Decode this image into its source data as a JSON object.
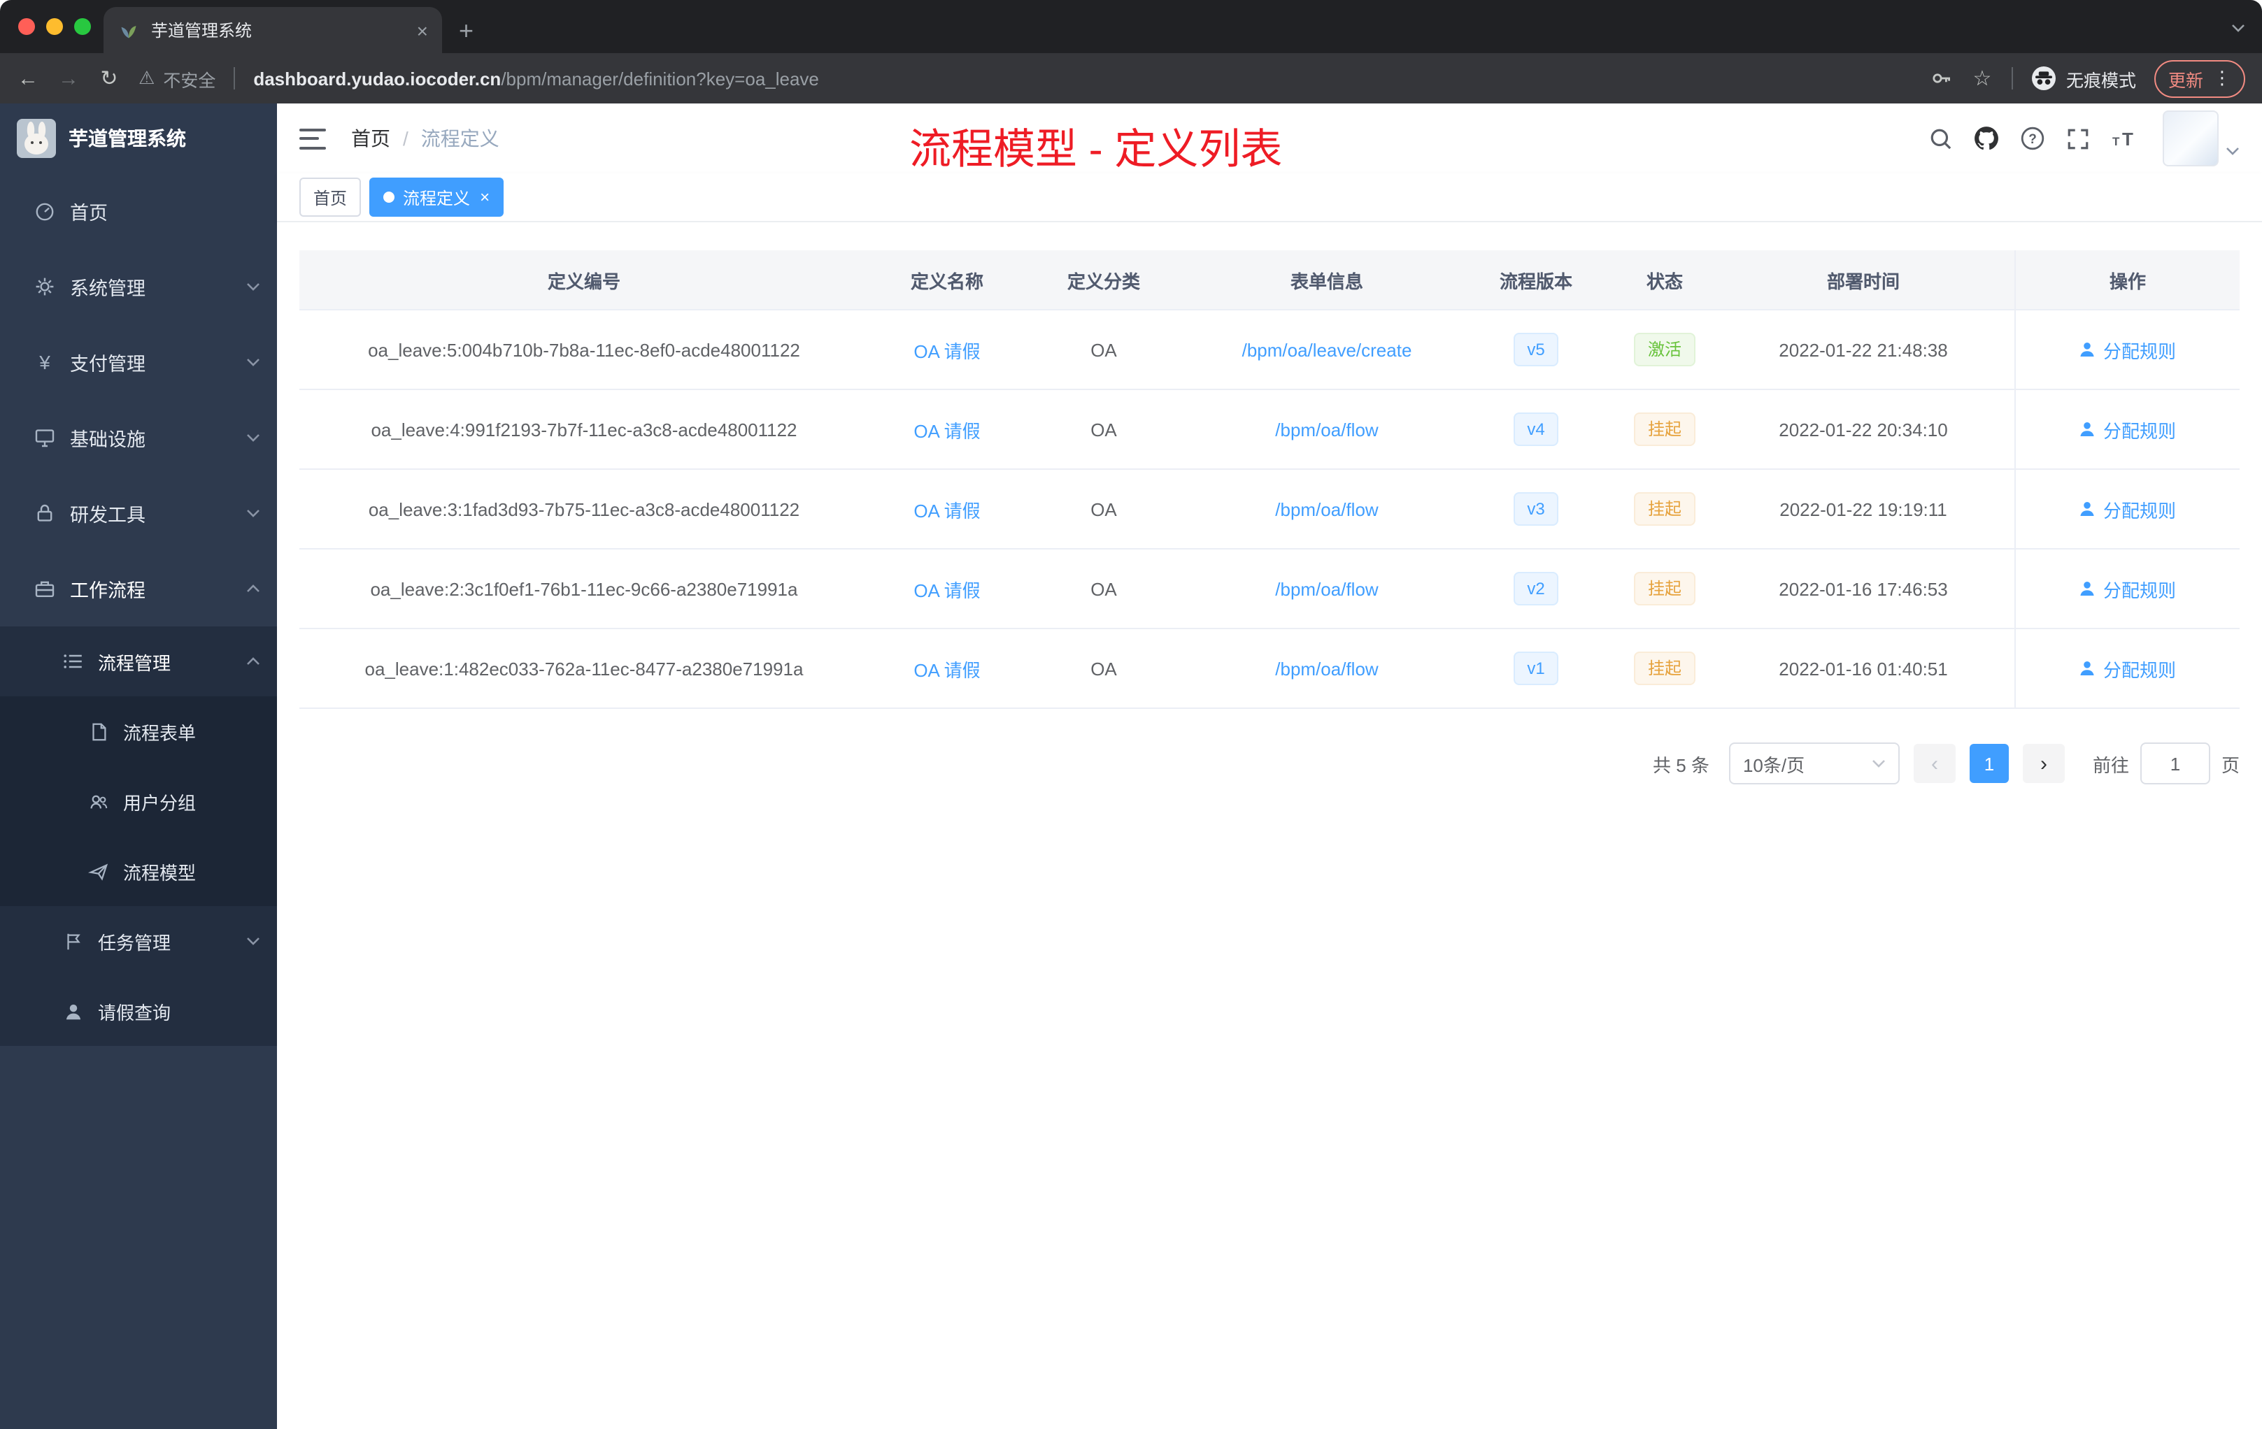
{
  "browser": {
    "tab_title": "芋道管理系统",
    "not_secure_label": "不安全",
    "url_domain": "dashboard.yudao.iocoder.cn",
    "url_path": "/bpm/manager/definition?key=oa_leave",
    "incognito_label": "无痕模式",
    "update_label": "更新"
  },
  "icons": {
    "back": "←",
    "forward": "→",
    "reload": "↻",
    "warning": "⚠",
    "star": "☆",
    "kebab": "⋮",
    "close": "×",
    "plus": "+",
    "angle_left": "‹",
    "angle_right": "›",
    "yen": "¥"
  },
  "sidebar": {
    "logo_title": "芋道管理系统",
    "items": [
      {
        "label": "首页"
      },
      {
        "label": "系统管理"
      },
      {
        "label": "支付管理"
      },
      {
        "label": "基础设施"
      },
      {
        "label": "研发工具"
      },
      {
        "label": "工作流程"
      }
    ],
    "workflow": {
      "process_mgmt": {
        "label": "流程管理"
      },
      "process_children": [
        {
          "label": "流程表单"
        },
        {
          "label": "用户分组"
        },
        {
          "label": "流程模型"
        }
      ],
      "task_mgmt": {
        "label": "任务管理"
      },
      "leave_query": {
        "label": "请假查询"
      }
    }
  },
  "header": {
    "breadcrumb_home": "首页",
    "breadcrumb_sep": "/",
    "breadcrumb_current": "流程定义",
    "overlay_title": "流程模型 - 定义列表"
  },
  "tags": {
    "home": "首页",
    "active": "流程定义"
  },
  "table": {
    "columns": [
      "定义编号",
      "定义名称",
      "定义分类",
      "表单信息",
      "流程版本",
      "状态",
      "部署时间",
      "操作"
    ],
    "rows": [
      {
        "id": "oa_leave:5:004b710b-7b8a-11ec-8ef0-acde48001122",
        "name": "OA 请假",
        "category": "OA",
        "form": "/bpm/oa/leave/create",
        "version": "v5",
        "status": "激活",
        "status_type": "success",
        "time": "2022-01-22 21:48:38",
        "action": "分配规则"
      },
      {
        "id": "oa_leave:4:991f2193-7b7f-11ec-a3c8-acde48001122",
        "name": "OA 请假",
        "category": "OA",
        "form": "/bpm/oa/flow",
        "version": "v4",
        "status": "挂起",
        "status_type": "warning",
        "time": "2022-01-22 20:34:10",
        "action": "分配规则"
      },
      {
        "id": "oa_leave:3:1fad3d93-7b75-11ec-a3c8-acde48001122",
        "name": "OA 请假",
        "category": "OA",
        "form": "/bpm/oa/flow",
        "version": "v3",
        "status": "挂起",
        "status_type": "warning",
        "time": "2022-01-22 19:19:11",
        "action": "分配规则"
      },
      {
        "id": "oa_leave:2:3c1f0ef1-76b1-11ec-9c66-a2380e71991a",
        "name": "OA 请假",
        "category": "OA",
        "form": "/bpm/oa/flow",
        "version": "v2",
        "status": "挂起",
        "status_type": "warning",
        "time": "2022-01-16 17:46:53",
        "action": "分配规则"
      },
      {
        "id": "oa_leave:1:482ec033-762a-11ec-8477-a2380e71991a",
        "name": "OA 请假",
        "category": "OA",
        "form": "/bpm/oa/flow",
        "version": "v1",
        "status": "挂起",
        "status_type": "warning",
        "time": "2022-01-16 01:40:51",
        "action": "分配规则"
      }
    ]
  },
  "pagination": {
    "total": "共 5 条",
    "page_size": "10条/页",
    "current": "1",
    "goto_label": "前往",
    "goto_value": "1",
    "page_unit": "页"
  }
}
